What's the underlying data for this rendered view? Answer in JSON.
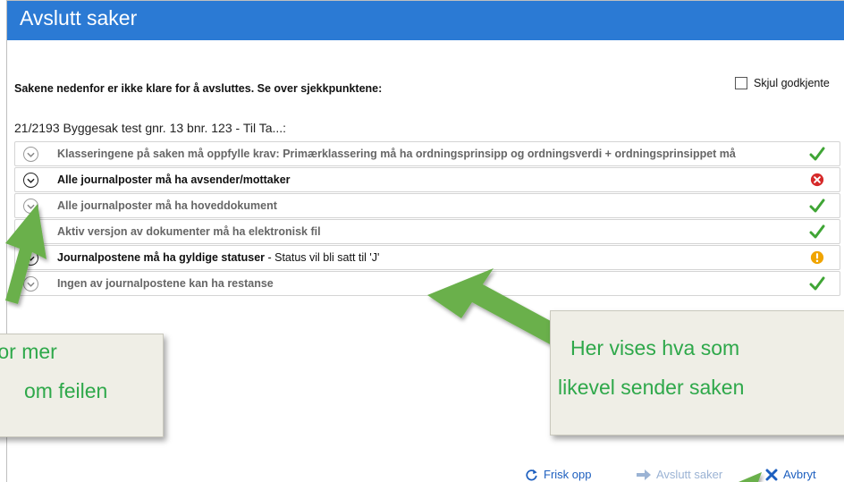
{
  "window": {
    "title": "Avslutt saker"
  },
  "instruction": "Sakene nedenfor er ikke klare for å avsluttes. Se over sjekkpunktene:",
  "hide_approved": {
    "label": "Skjul godkjente",
    "checked": false
  },
  "case_title": "21/2193 Byggesak test gnr. 13 bnr. 123 - Til Ta...:",
  "checks": [
    {
      "label": "Klasseringene på saken må oppfylle krav: Primærklassering må ha ordningsprinsipp og ordningsverdi + ordningsprinsippet må",
      "detail": "",
      "status": "ok",
      "expanded_style": "light"
    },
    {
      "label": "Alle journalposter må ha avsender/mottaker",
      "detail": "",
      "status": "error",
      "expanded_style": "dark"
    },
    {
      "label": "Alle journalposter må ha hoveddokument",
      "detail": "",
      "status": "ok",
      "expanded_style": "light"
    },
    {
      "label": "Aktiv versjon av dokumenter må ha elektronisk fil",
      "detail": "",
      "status": "ok",
      "expanded_style": "light"
    },
    {
      "label": "Journalpostene må ha gyldige statuser",
      "detail": " - Status vil bli satt til 'J'",
      "status": "warning",
      "expanded_style": "dark"
    },
    {
      "label": "Ingen av journalpostene kan ha restanse",
      "detail": "",
      "status": "ok",
      "expanded_style": "light"
    }
  ],
  "callouts": {
    "left": {
      "line1": "for mer",
      "line2": "om feilen"
    },
    "right": {
      "line1": "Her vises hva som",
      "line2": "likevel sender saken"
    }
  },
  "actions": {
    "refresh": "Frisk opp",
    "close_cases": "Avslutt saker",
    "cancel": "Avbryt"
  },
  "colors": {
    "titlebar": "#2b7ad4",
    "ok": "#3fa535",
    "error": "#d62a2a",
    "warning": "#f0a400",
    "callout_text": "#2ea84a",
    "arrow": "#6ab04c"
  }
}
